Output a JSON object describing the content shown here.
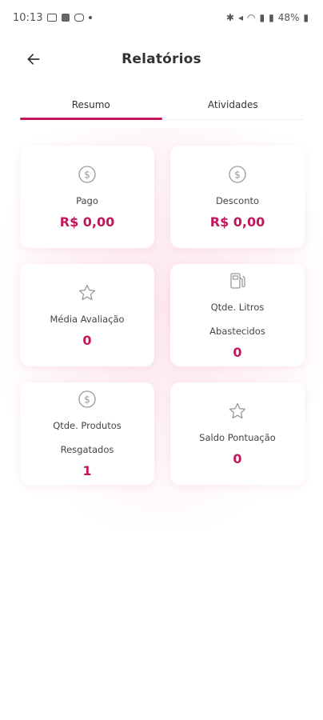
{
  "status_bar": {
    "time": "10:13",
    "battery": "48%"
  },
  "header": {
    "title": "Relatórios",
    "back_icon": "arrow-left-icon"
  },
  "tabs": [
    {
      "label": "Resumo",
      "active": true
    },
    {
      "label": "Atividades",
      "active": false
    }
  ],
  "accent_color": "#c2185b",
  "cards": [
    {
      "icon": "dollar-circle-icon",
      "label_line1": "Pago",
      "label_line2": "",
      "value": "R$ 0,00"
    },
    {
      "icon": "dollar-circle-icon",
      "label_line1": "Desconto",
      "label_line2": "",
      "value": "R$ 0,00"
    },
    {
      "icon": "star-icon",
      "label_line1": "Média Avaliação",
      "label_line2": "",
      "value": "0"
    },
    {
      "icon": "fuel-pump-icon",
      "label_line1": "Qtde. Litros",
      "label_line2": "Abastecidos",
      "value": "0"
    },
    {
      "icon": "dollar-circle-icon",
      "label_line1": "Qtde. Produtos",
      "label_line2": "Resgatados",
      "value": "1"
    },
    {
      "icon": "star-icon",
      "label_line1": "Saldo Pontuação",
      "label_line2": "",
      "value": "0"
    }
  ]
}
